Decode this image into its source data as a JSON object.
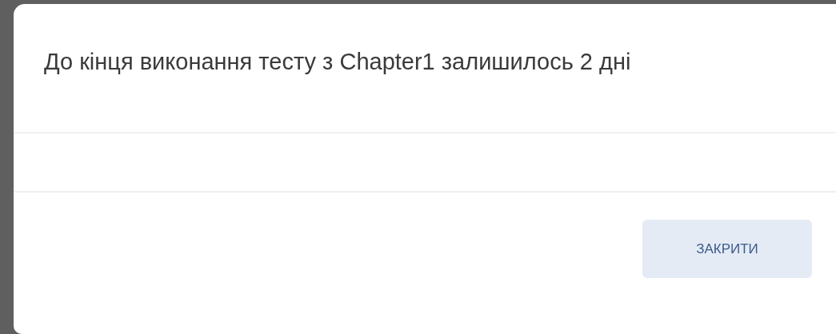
{
  "dialog": {
    "message": "До кінця виконання тесту з Chapter1 залишилось 2 дні",
    "buttons": [
      "ЗАКРИТИ"
    ]
  }
}
